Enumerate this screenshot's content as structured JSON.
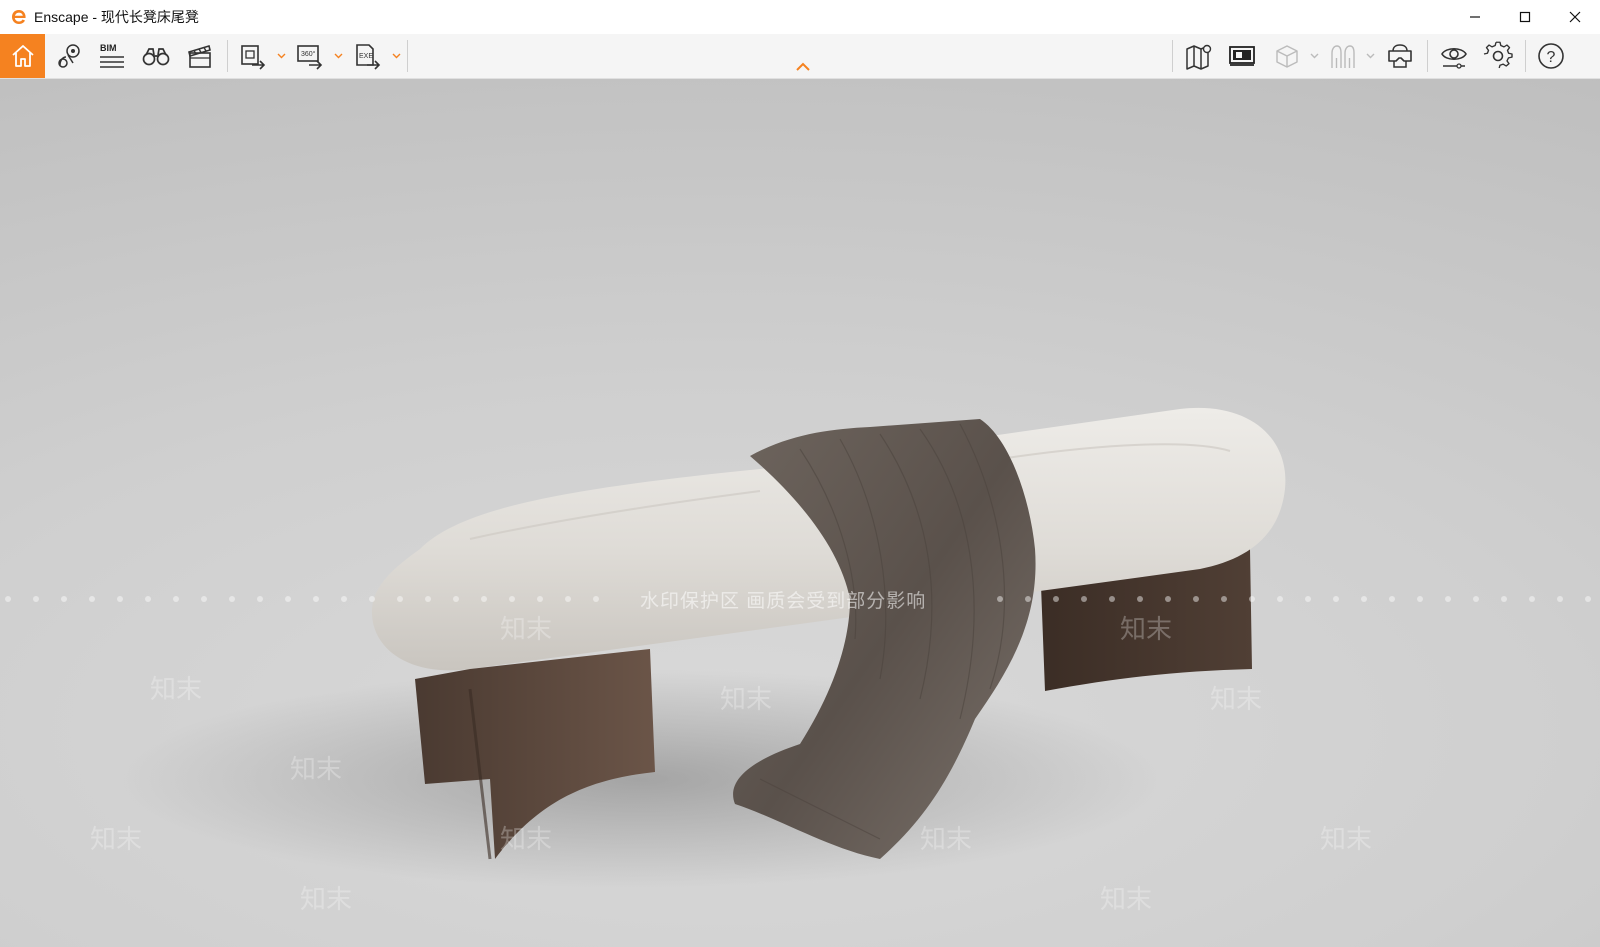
{
  "window": {
    "app_name": "Enscape",
    "title": "Enscape - 现代长凳床尾凳",
    "accent_color": "#f58220"
  },
  "toolbar": {
    "left_items": [
      {
        "name": "home-icon",
        "active": true
      },
      {
        "name": "location-pin-icon"
      },
      {
        "name": "bim-icon",
        "label": "BIM"
      },
      {
        "name": "binoculars-icon"
      },
      {
        "name": "video-editor-icon"
      },
      {
        "name": "render-screenshot-icon",
        "has_dropdown": true
      },
      {
        "name": "panorama-360-icon",
        "label": "360°",
        "has_dropdown": true
      },
      {
        "name": "export-exe-icon",
        "label": "EXE",
        "has_dropdown": true
      }
    ],
    "right_items": [
      {
        "name": "map-icon"
      },
      {
        "name": "monitor-icon"
      },
      {
        "name": "cube-icon",
        "has_dropdown": true,
        "disabled": true
      },
      {
        "name": "human-figure-icon",
        "has_dropdown": true,
        "disabled": true
      },
      {
        "name": "vr-headset-icon"
      },
      {
        "name": "eye-visual-settings-icon"
      },
      {
        "name": "gear-icon"
      },
      {
        "name": "help-icon",
        "label": "?"
      }
    ]
  },
  "viewport": {
    "watermark_banner": "水印保护区  画质会受到部分影响",
    "watermark_mark": "知末"
  }
}
